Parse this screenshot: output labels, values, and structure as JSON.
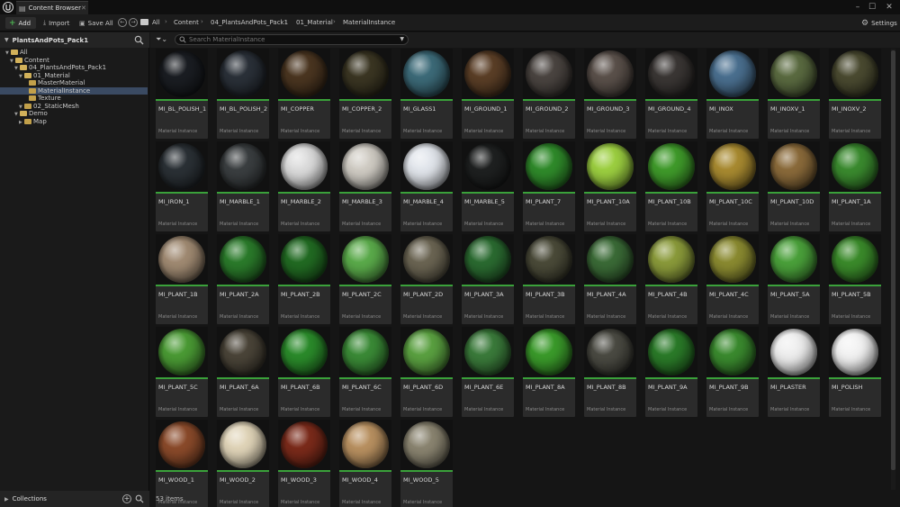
{
  "window": {
    "tab_label": "Content Browser",
    "tab_icon": "content-browser-icon",
    "close_tab": "✕",
    "minimize": "–",
    "maximize": "☐",
    "close": "✕"
  },
  "toolbar": {
    "add_plus": "+",
    "add_label": "Add",
    "import_label": "Import",
    "save_all_label": "Save All",
    "back": "←",
    "forward": "→",
    "breadcrumbs": [
      "All",
      "Content",
      "04_PlantsAndPots_Pack1",
      "01_Material",
      "MaterialInstance"
    ],
    "crumb_sep": "›",
    "settings_label": "Settings",
    "settings_icon": "⚙"
  },
  "sidebar": {
    "title": "PlantsAndPots_Pack1",
    "tree": [
      {
        "label": "All",
        "level": 0
      },
      {
        "label": "Content",
        "level": 1
      },
      {
        "label": "04_PlantsAndPots_Pack1",
        "level": 2
      },
      {
        "label": "01_Material",
        "level": 3
      },
      {
        "label": "MasterMaterial",
        "level": 4
      },
      {
        "label": "MaterialInstance",
        "level": 4,
        "selected": true
      },
      {
        "label": "Texture",
        "level": 4
      },
      {
        "label": "02_StaticMesh",
        "level": 3
      },
      {
        "label": "Demo",
        "level": 2
      },
      {
        "label": "Map",
        "level": 3
      }
    ],
    "collections_label": "Collections",
    "collections_add": "+"
  },
  "search": {
    "placeholder": "Search MaterialInstance"
  },
  "asset_type_label": "Material Instance",
  "assets": [
    {
      "name": "MI_BL_POLISH_1",
      "color": "#1a1d22"
    },
    {
      "name": "MI_BL_POLISH_2",
      "color": "#2a3038"
    },
    {
      "name": "MI_COPPER",
      "color": "#4a3520"
    },
    {
      "name": "MI_COPPER_2",
      "color": "#3a3522"
    },
    {
      "name": "MI_GLASS1",
      "color": "#3c6a78"
    },
    {
      "name": "MI_GROUND_1",
      "color": "#5a3e26"
    },
    {
      "name": "MI_GROUND_2",
      "color": "#4a4440"
    },
    {
      "name": "MI_GROUND_3",
      "color": "#5a504a"
    },
    {
      "name": "MI_GROUND_4",
      "color": "#3a3634"
    },
    {
      "name": "MI_INOX",
      "color": "#4a6f8f"
    },
    {
      "name": "MI_INOXV_1",
      "color": "#5a6a40"
    },
    {
      "name": "MI_INOXV_2",
      "color": "#4a4a30"
    },
    {
      "name": "MI_IRON_1",
      "color": "#2a3035"
    },
    {
      "name": "MI_MARBLE_1",
      "color": "#3a3e40"
    },
    {
      "name": "MI_MARBLE_2",
      "color": "#dcdcdc"
    },
    {
      "name": "MI_MARBLE_3",
      "color": "#d0ccc4"
    },
    {
      "name": "MI_MARBLE_4",
      "color": "#e2e6ec"
    },
    {
      "name": "MI_MARBLE_5",
      "color": "#1e2020"
    },
    {
      "name": "MI_PLANT_7",
      "color": "#2f8a2a"
    },
    {
      "name": "MI_PLANT_10A",
      "color": "#9ccf40"
    },
    {
      "name": "MI_PLANT_10B",
      "color": "#3f9a2a"
    },
    {
      "name": "MI_PLANT_10C",
      "color": "#a88a30"
    },
    {
      "name": "MI_PLANT_10D",
      "color": "#8a6a3a"
    },
    {
      "name": "MI_PLANT_1A",
      "color": "#3a8a2e"
    },
    {
      "name": "MI_PLANT_1B",
      "color": "#a08a72"
    },
    {
      "name": "MI_PLANT_2A",
      "color": "#2a7a2a"
    },
    {
      "name": "MI_PLANT_2B",
      "color": "#216a22"
    },
    {
      "name": "MI_PLANT_2C",
      "color": "#5aaa4a"
    },
    {
      "name": "MI_PLANT_2D",
      "color": "#6a6452"
    },
    {
      "name": "MI_PLANT_3A",
      "color": "#2a6a30"
    },
    {
      "name": "MI_PLANT_3B",
      "color": "#4a4a38"
    },
    {
      "name": "MI_PLANT_4A",
      "color": "#3a6a36"
    },
    {
      "name": "MI_PLANT_4B",
      "color": "#8a9a3a"
    },
    {
      "name": "MI_PLANT_4C",
      "color": "#8a8a30"
    },
    {
      "name": "MI_PLANT_5A",
      "color": "#4aa03a"
    },
    {
      "name": "MI_PLANT_5B",
      "color": "#3a8a2a"
    },
    {
      "name": "MI_PLANT_5C",
      "color": "#4a9a34"
    },
    {
      "name": "MI_PLANT_6A",
      "color": "#4a4438"
    },
    {
      "name": "MI_PLANT_6B",
      "color": "#2a8a2a"
    },
    {
      "name": "MI_PLANT_6C",
      "color": "#3a8a36"
    },
    {
      "name": "MI_PLANT_6D",
      "color": "#5aa040"
    },
    {
      "name": "MI_PLANT_6E",
      "color": "#3a7a3a"
    },
    {
      "name": "MI_PLANT_8A",
      "color": "#3a9a2a"
    },
    {
      "name": "MI_PLANT_8B",
      "color": "#4a4a42"
    },
    {
      "name": "MI_PLANT_9A",
      "color": "#2a7a28"
    },
    {
      "name": "MI_PLANT_9B",
      "color": "#3a8a2e"
    },
    {
      "name": "MI_PLASTER",
      "color": "#eeeeee"
    },
    {
      "name": "MI_POLISH",
      "color": "#f2f2f2"
    },
    {
      "name": "MI_WOOD_1",
      "color": "#8a4a2a"
    },
    {
      "name": "MI_WOOD_2",
      "color": "#e0d4b8"
    },
    {
      "name": "MI_WOOD_3",
      "color": "#7a2a1a"
    },
    {
      "name": "MI_WOOD_4",
      "color": "#b89060"
    },
    {
      "name": "MI_WOOD_5",
      "color": "#8a8470"
    }
  ],
  "status": {
    "item_count": "53 items"
  },
  "colors": {
    "accent_green": "#3aa13a",
    "selection": "#3a4a62",
    "folder": "#c2a04a"
  }
}
